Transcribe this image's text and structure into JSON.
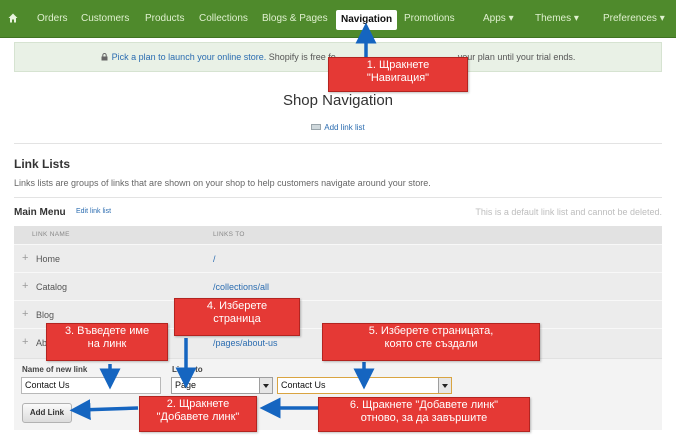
{
  "topnav": {
    "items": [
      "Orders",
      "Customers",
      "Products",
      "Collections",
      "Blogs & Pages",
      "Navigation",
      "Promotions",
      "Apps ▾",
      "Themes ▾",
      "Preferences ▾"
    ],
    "active": "Navigation"
  },
  "banner": {
    "link_text": "Pick a plan to launch your online store.",
    "text_before": "Shopify is free fo",
    "text_after": "your plan until your trial ends."
  },
  "page": {
    "title": "Shop Navigation",
    "add_link_list": "Add link list"
  },
  "link_lists": {
    "heading": "Link Lists",
    "description": "Links lists are groups of links that are shown on your shop to help customers navigate around your store."
  },
  "main_menu": {
    "heading": "Main Menu",
    "edit_label": "Edit link list",
    "default_note": "This is a default link list and cannot be deleted."
  },
  "table": {
    "headers": [
      "LINK NAME",
      "LINKS TO"
    ],
    "rows": [
      {
        "name": "Home",
        "to": "/"
      },
      {
        "name": "Catalog",
        "to": "/collections/all"
      },
      {
        "name": "Blog",
        "to": ""
      },
      {
        "name": "Ab",
        "to": "/pages/about-us"
      }
    ]
  },
  "new_link": {
    "name_label": "Name of new link",
    "name_value": "Contact Us",
    "links_to_label": "Links to",
    "type_value": "Page",
    "page_value": "Contact Us",
    "button_label": "Add Link"
  },
  "annotations": {
    "step1": [
      "1. Щракнете",
      "\"Навигация\""
    ],
    "step2": [
      "2. Щракнете",
      "\"Добавете линк\""
    ],
    "step3": [
      "3. Въведете име",
      "на линк"
    ],
    "step4": [
      "4. Изберете",
      "страница"
    ],
    "step5": [
      "5. Изберете страницата,",
      "която сте създали"
    ],
    "step6": [
      "6. Щракнете \"Добавете линк\"",
      "отново, за да завършите"
    ]
  },
  "colors": {
    "nav_bg": "#4f8a2c",
    "link": "#2b6cb0",
    "callout": "#e53935",
    "arrow": "#1565c0"
  }
}
